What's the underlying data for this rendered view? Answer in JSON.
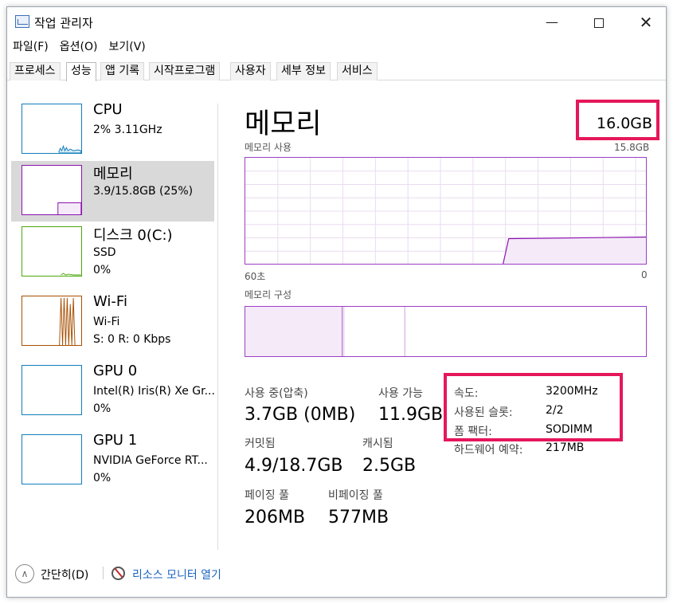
{
  "window": {
    "title": "작업 관리자",
    "controls": {
      "minimize": "—",
      "close": "✕"
    }
  },
  "menu": [
    "파일(F)",
    "옵션(O)",
    "보기(V)"
  ],
  "tabs": [
    "프로세스",
    "성능",
    "앱 기록",
    "시작프로그램",
    "사용자",
    "세부 정보",
    "서비스"
  ],
  "active_tab": "성능",
  "sidebar": [
    {
      "title": "CPU",
      "sub": "2% 3.11GHz",
      "sub2": "",
      "color": "#117dbb"
    },
    {
      "title": "메모리",
      "sub": "3.9/15.8GB (25%)",
      "sub2": "",
      "color": "#8b12ae"
    },
    {
      "title": "디스크 0(C:)",
      "sub": "SSD",
      "sub2": "0%",
      "color": "#4da60c"
    },
    {
      "title": "Wi-Fi",
      "sub": "Wi-Fi",
      "sub2": "S: 0 R: 0 Kbps",
      "color": "#a74f01"
    },
    {
      "title": "GPU 0",
      "sub": "Intel(R) Iris(R) Xe Gr...",
      "sub2": "0%",
      "color": "#117dbb"
    },
    {
      "title": "GPU 1",
      "sub": "NVIDIA GeForce RT...",
      "sub2": "0%",
      "color": "#117dbb"
    }
  ],
  "main": {
    "title": "메모리",
    "total": "16.0GB",
    "usage_label": "메모리 사용",
    "usage_max": "15.8GB",
    "time_left": "60초",
    "time_right": "0",
    "composition_label": "메모리 구성",
    "stats": {
      "in_use_label": "사용 중(압축)",
      "in_use": "3.7GB (0MB)",
      "available_label": "사용 가능",
      "available": "11.9GB",
      "committed_label": "커밋됨",
      "committed": "4.9/18.7GB",
      "cached_label": "캐시됨",
      "cached": "2.5GB",
      "paged_label": "페이징 풀",
      "paged": "206MB",
      "nonpaged_label": "비페이징 풀",
      "nonpaged": "577MB"
    },
    "props": [
      {
        "label": "속도:",
        "value": "3200MHz"
      },
      {
        "label": "사용된 슬롯:",
        "value": "2/2"
      },
      {
        "label": "폼 팩터:",
        "value": "SODIMM"
      },
      {
        "label": "하드웨어 예약:",
        "value": "217MB"
      }
    ]
  },
  "footer": {
    "fewer_details": "간단히(D)",
    "resource_monitor": "리소스 모니터 열기"
  },
  "colors": {
    "memory": "#8b12ae",
    "highlight": "#e5175b",
    "link": "#1b63c1"
  }
}
